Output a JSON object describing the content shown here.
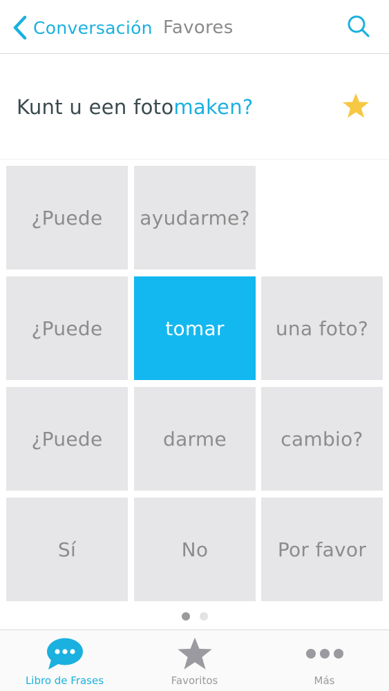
{
  "navbar": {
    "back_label": "Conversación",
    "title": "Favores"
  },
  "phrase": {
    "part_plain": "Kunt u een foto ",
    "part_highlight": "maken?",
    "starred": true
  },
  "grid": {
    "rows": [
      [
        "¿Puede",
        "ayudarme?",
        ""
      ],
      [
        "¿Puede",
        "tomar",
        "una foto?"
      ],
      [
        "¿Puede",
        "darme",
        "cambio?"
      ],
      [
        "Sí",
        "No",
        "Por favor"
      ]
    ],
    "active_tile": "tomar"
  },
  "pager": {
    "pages": 2,
    "current": 1
  },
  "tabs": [
    {
      "label": "Libro de Frases",
      "icon": "chat-bubble-icon",
      "active": true
    },
    {
      "label": "Favoritos",
      "icon": "star-icon",
      "active": false
    },
    {
      "label": "Más",
      "icon": "more-dots-icon",
      "active": false
    }
  ],
  "colors": {
    "accent": "#1ab0e0",
    "tile": "#e6e6e8",
    "tile_active": "#14b8f0",
    "star": "#f6c843"
  }
}
